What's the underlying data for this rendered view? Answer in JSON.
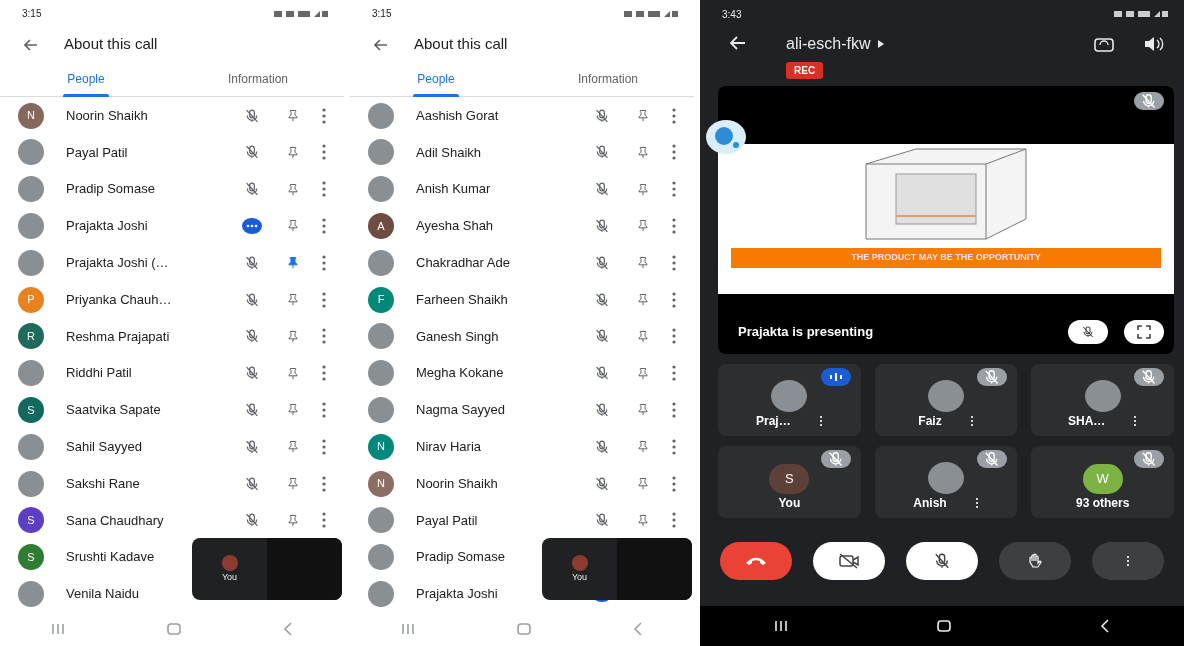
{
  "panels": [
    {
      "kind": "list",
      "status_time": "3:15",
      "title": "About this call",
      "tabs": [
        {
          "label": "People",
          "selected": true
        },
        {
          "label": "Information",
          "selected": false
        }
      ],
      "people": [
        {
          "name": "Noorin Shaikh",
          "avatar": {
            "kind": "letter",
            "letter": "N",
            "color": "#86695d"
          },
          "speaking": false,
          "pinned": false
        },
        {
          "name": "Payal Patil",
          "avatar": {
            "kind": "photo"
          },
          "speaking": false,
          "pinned": false
        },
        {
          "name": "Pradip Somase",
          "avatar": {
            "kind": "photo"
          },
          "speaking": false,
          "pinned": false
        },
        {
          "name": "Prajakta Joshi",
          "avatar": {
            "kind": "photo"
          },
          "speaking": true,
          "pinned": false
        },
        {
          "name": "Prajakta Joshi (…",
          "avatar": {
            "kind": "photo"
          },
          "speaking": false,
          "pinned": true
        },
        {
          "name": "Priyanka Chauh…",
          "avatar": {
            "kind": "letter",
            "letter": "P",
            "color": "#e8821e"
          },
          "speaking": false,
          "pinned": false
        },
        {
          "name": "Reshma Prajapati",
          "avatar": {
            "kind": "letter",
            "letter": "R",
            "color": "#1e6b5c"
          },
          "speaking": false,
          "pinned": false
        },
        {
          "name": "Riddhi Patil",
          "avatar": {
            "kind": "photo"
          },
          "speaking": false,
          "pinned": false
        },
        {
          "name": "Saatvika Sapate",
          "avatar": {
            "kind": "letter",
            "letter": "S",
            "color": "#13695e"
          },
          "speaking": false,
          "pinned": false
        },
        {
          "name": "Sahil Sayyed",
          "avatar": {
            "kind": "photo"
          },
          "speaking": false,
          "pinned": false
        },
        {
          "name": "Sakshi Rane",
          "avatar": {
            "kind": "photo"
          },
          "speaking": false,
          "pinned": false
        },
        {
          "name": "Sana Chaudhary",
          "avatar": {
            "kind": "letter",
            "letter": "S",
            "color": "#5c3fc4"
          },
          "speaking": false,
          "pinned": false
        },
        {
          "name": "Srushti Kadave",
          "avatar": {
            "kind": "letter",
            "letter": "S",
            "color": "#2e7d32"
          }
        },
        {
          "name": "Venila Naidu",
          "avatar": {
            "kind": "photo"
          }
        }
      ],
      "mini_window": {
        "self_label": "You"
      }
    },
    {
      "kind": "list",
      "status_time": "3:15",
      "title": "About this call",
      "tabs": [
        {
          "label": "People",
          "selected": true
        },
        {
          "label": "Information",
          "selected": false
        }
      ],
      "people": [
        {
          "name": "Aashish Gorat",
          "avatar": {
            "kind": "photo"
          },
          "speaking": false,
          "pinned": false
        },
        {
          "name": "Adil Shaikh",
          "avatar": {
            "kind": "photo"
          },
          "speaking": false,
          "pinned": false
        },
        {
          "name": "Anish Kumar",
          "avatar": {
            "kind": "photo"
          },
          "speaking": false,
          "pinned": false
        },
        {
          "name": "Ayesha Shah",
          "avatar": {
            "kind": "letter",
            "letter": "A",
            "color": "#6d4c41"
          },
          "speaking": false,
          "pinned": false
        },
        {
          "name": "Chakradhar Ade",
          "avatar": {
            "kind": "photo"
          },
          "speaking": false,
          "pinned": false
        },
        {
          "name": "Farheen Shaikh",
          "avatar": {
            "kind": "letter",
            "letter": "F",
            "color": "#00897b"
          },
          "speaking": false,
          "pinned": false
        },
        {
          "name": "Ganesh Singh",
          "avatar": {
            "kind": "photo"
          },
          "speaking": false,
          "pinned": false
        },
        {
          "name": "Megha Kokane",
          "avatar": {
            "kind": "photo"
          },
          "speaking": false,
          "pinned": false
        },
        {
          "name": "Nagma Sayyed",
          "avatar": {
            "kind": "photo"
          },
          "speaking": false,
          "pinned": false
        },
        {
          "name": "Nirav Haria",
          "avatar": {
            "kind": "letter",
            "letter": "N",
            "color": "#00897b"
          },
          "speaking": false,
          "pinned": false
        },
        {
          "name": "Noorin Shaikh",
          "avatar": {
            "kind": "letter",
            "letter": "N",
            "color": "#8d6e63"
          },
          "speaking": false,
          "pinned": false
        },
        {
          "name": "Payal Patil",
          "avatar": {
            "kind": "photo"
          },
          "speaking": false,
          "pinned": false
        },
        {
          "name": "Pradip Somase",
          "avatar": {
            "kind": "photo"
          }
        },
        {
          "name": "Prajakta Joshi",
          "avatar": {
            "kind": "photo"
          },
          "speaking": true
        }
      ],
      "mini_window": {
        "self_label": "You"
      }
    },
    {
      "kind": "call",
      "status_time": "3:43",
      "meeting_code": "ali-esch-fkw",
      "rec_label": "REC",
      "slide_banner": "THE PRODUCT MAY BE THE OPPORTUNITY",
      "presenter_caption": "Prajakta is presenting",
      "tiles": [
        {
          "name": "Praj…",
          "avatar": {
            "kind": "photo"
          },
          "speaking": true,
          "has_menu": true
        },
        {
          "name": "Faiz",
          "avatar": {
            "kind": "photo"
          },
          "speaking": false,
          "has_menu": true
        },
        {
          "name": "SHA…",
          "avatar": {
            "kind": "photo"
          },
          "speaking": false,
          "has_menu": true
        },
        {
          "name": "You",
          "avatar": {
            "kind": "letter",
            "letter": "S",
            "color": "#5d4037"
          },
          "speaking": false,
          "has_menu": false
        },
        {
          "name": "Anish",
          "avatar": {
            "kind": "photo"
          },
          "speaking": false,
          "has_menu": true
        },
        {
          "name": "93 others",
          "avatar": {
            "kind": "letter",
            "letter": "W",
            "color": "#7cb342"
          },
          "speaking": false,
          "has_menu": false
        }
      ],
      "controls": [
        {
          "kind": "end_call"
        },
        {
          "kind": "camera_off"
        },
        {
          "kind": "mic_off"
        },
        {
          "kind": "raise_hand"
        },
        {
          "kind": "more"
        }
      ]
    }
  ]
}
